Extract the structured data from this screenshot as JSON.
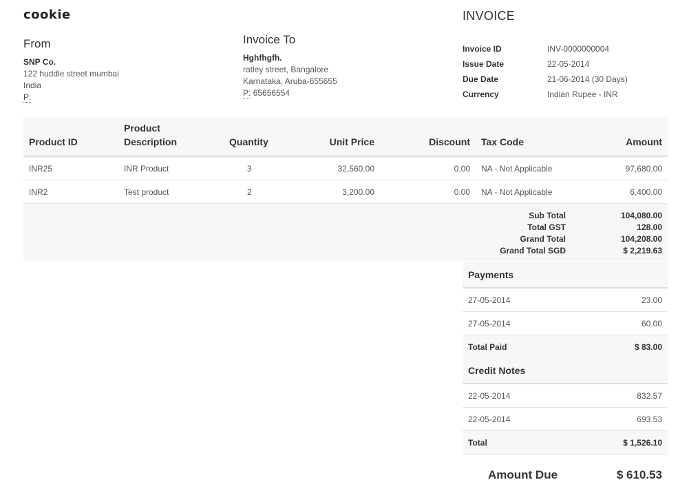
{
  "logo": "cookie",
  "invoice_title": "INVOICE",
  "from": {
    "title": "From",
    "name": "SNP Co.",
    "line1": "122 huddle street mumbai",
    "line2": "India",
    "phone_label": "P:",
    "phone": ""
  },
  "to": {
    "title": "Invoice To",
    "name": "Hghfhgfh.",
    "line1": "ratley street, Bangalore",
    "line2": "Karnataka, Aruba-655655",
    "phone_label": "P:",
    "phone": " 65656554"
  },
  "meta": [
    {
      "key": "Invoice ID",
      "value": "INV-0000000004"
    },
    {
      "key": "Issue Date",
      "value": "22-05-2014"
    },
    {
      "key": "Due Date",
      "value": "21-06-2014 (30 Days)"
    },
    {
      "key": "Currency",
      "value": "Indian Rupee - INR"
    }
  ],
  "items_header": {
    "product_id": "Product ID",
    "product_desc_1": "Product",
    "product_desc_2": "Description",
    "quantity": "Quantity",
    "unit_price": "Unit Price",
    "discount": "Discount",
    "tax_code": "Tax Code",
    "amount": "Amount"
  },
  "items": [
    {
      "id": "INR25",
      "desc": "INR Product",
      "qty": "3",
      "unit": "32,560.00",
      "discount": "0.00",
      "tax": "NA - Not Applicable",
      "amount": "97,680.00"
    },
    {
      "id": "INR2",
      "desc": "Test product",
      "qty": "2",
      "unit": "3,200.00",
      "discount": "0.00",
      "tax": "NA - Not Applicable",
      "amount": "6,400.00"
    }
  ],
  "totals": [
    {
      "label": "Sub Total",
      "value": "104,080.00"
    },
    {
      "label": "Total GST",
      "value": "128.00"
    },
    {
      "label": "Grand Total",
      "value": "104,208.00"
    },
    {
      "label": "Grand Total SGD",
      "value": "$ 2,219.63"
    }
  ],
  "payments": {
    "title": "Payments",
    "rows": [
      {
        "date": "27-05-2014",
        "amount": "23.00"
      },
      {
        "date": "27-05-2014",
        "amount": "60.00"
      }
    ],
    "total_label": "Total Paid",
    "total_value": "$ 83.00"
  },
  "credit_notes": {
    "title": "Credit Notes",
    "rows": [
      {
        "date": "22-05-2014",
        "amount": "832.57"
      },
      {
        "date": "22-05-2014",
        "amount": "693.53"
      }
    ],
    "total_label": "Total",
    "total_value": "$ 1,526.10"
  },
  "amount_due": {
    "label": "Amount Due",
    "value": "$ 610.53"
  }
}
